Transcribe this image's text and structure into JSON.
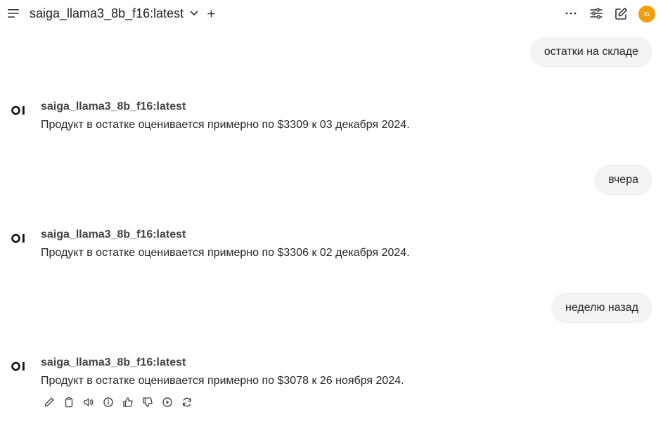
{
  "header": {
    "model_title": "saiga_llama3_8b_f16:latest",
    "avatar_initials": "IG",
    "avatar_color": "#f59e0b",
    "icons": [
      "menu-icon",
      "chevron-down-icon",
      "plus-icon",
      "more-icon",
      "sliders-icon",
      "edit-icon"
    ]
  },
  "messages": [
    {
      "role": "user",
      "text": "остатки на складе"
    },
    {
      "role": "assistant",
      "model": "saiga_llama3_8b_f16:latest",
      "text": "Продукт в остатке оценивается примерно по $3309 к 03 декабря 2024."
    },
    {
      "role": "user",
      "text": "вчера"
    },
    {
      "role": "assistant",
      "model": "saiga_llama3_8b_f16:latest",
      "text": "Продукт в остатке оценивается примерно по $3306 к 02 декабря 2024."
    },
    {
      "role": "user",
      "text": "неделю назад"
    },
    {
      "role": "assistant",
      "model": "saiga_llama3_8b_f16:latest",
      "text": "Продукт в остатке оценивается примерно по $3078 к 26 ноября 2024."
    }
  ],
  "assistant_logo": "OI",
  "message_actions": [
    "edit-icon",
    "copy-icon",
    "read-aloud-icon",
    "info-icon",
    "thumbs-up-icon",
    "thumbs-down-icon",
    "continue-icon",
    "regenerate-icon"
  ]
}
